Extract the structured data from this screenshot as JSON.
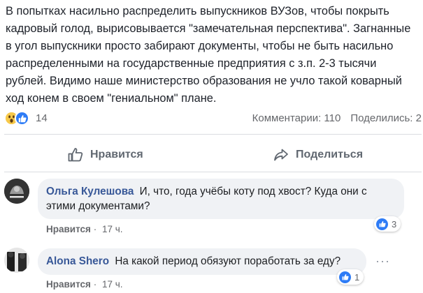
{
  "post": {
    "text": "В попытках насильно распределить выпускников ВУЗов, чтобы покрыть кадровый голод, вырисовывается \"замечательная перспектива\". Загнанные в угол выпускники просто забирают документы, чтобы не быть насильно распределенными на государственные предприятия с з.п. 2-3 тысячи рублей. Видимо наше министерство образования не учло такой коварный ход конем в своем \"гениальном\" плане."
  },
  "stats": {
    "reaction_count": "14",
    "comments": "Комментарии: 110",
    "shares": "Поделились: 2",
    "reaction_icons": [
      "wow-icon",
      "like-icon"
    ]
  },
  "actions": {
    "like_label": "Нравится",
    "share_label": "Поделиться"
  },
  "comments": [
    {
      "author": "Ольга Кулешова",
      "text": "И, что, года учёбы коту под хвост? Куда они с этими документами?",
      "like_label": "Нравится",
      "separator": "·",
      "time": "17 ч.",
      "reactions": "3"
    },
    {
      "author": "Alona Shero",
      "text": "На какой период обязуют поработать за еду?",
      "like_label": "Нравится",
      "separator": "·",
      "time": "17 ч.",
      "reactions": "1",
      "more": "···"
    }
  ],
  "colors": {
    "link": "#385898",
    "muted": "#65676b",
    "like_blue": "#2e7cf6",
    "bubble": "#f0f2f5"
  }
}
